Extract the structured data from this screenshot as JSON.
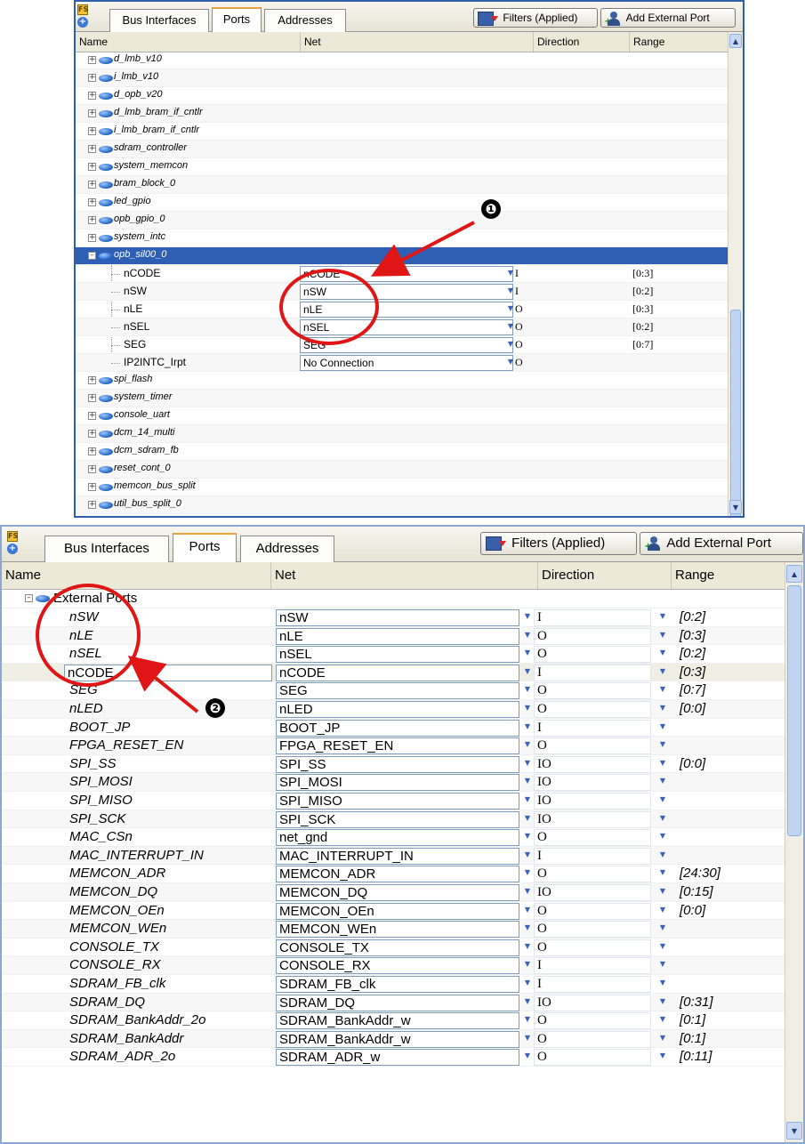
{
  "toolbar": {
    "tabs": [
      "Bus Interfaces",
      "Ports",
      "Addresses"
    ],
    "filters_label": "Filters (Applied)",
    "add_port_label": "Add External Port"
  },
  "columns": [
    "Name",
    "Net",
    "Direction",
    "Range"
  ],
  "top_panel": {
    "instances_before": [
      "d_lmb_v10",
      "i_lmb_v10",
      "d_opb_v20",
      "d_lmb_bram_if_cntlr",
      "i_lmb_bram_if_cntlr",
      "sdram_controller",
      "system_memcon",
      "bram_block_0",
      "led_gpio",
      "opb_gpio_0",
      "system_intc"
    ],
    "selected_instance": "opb_sil00_0",
    "ports": [
      {
        "name": "nCODE",
        "net": "nCODE",
        "dir": "I",
        "range": "[0:3]"
      },
      {
        "name": "nSW",
        "net": "nSW",
        "dir": "I",
        "range": "[0:2]"
      },
      {
        "name": "nLE",
        "net": "nLE",
        "dir": "O",
        "range": "[0:3]"
      },
      {
        "name": "nSEL",
        "net": "nSEL",
        "dir": "O",
        "range": "[0:2]"
      },
      {
        "name": "SEG",
        "net": "SEG",
        "dir": "O",
        "range": "[0:7]"
      },
      {
        "name": "IP2INTC_Irpt",
        "net": "No Connection",
        "dir": "O",
        "range": ""
      }
    ],
    "instances_after": [
      "spi_flash",
      "system_timer",
      "console_uart",
      "dcm_14_multi",
      "dcm_sdram_fb",
      "reset_cont_0",
      "memcon_bus_split",
      "util_bus_split_0"
    ]
  },
  "bottom_panel": {
    "group": "External Ports",
    "ports": [
      {
        "name": "nSW",
        "net": "nSW",
        "dir": "I",
        "range": "[0:2]"
      },
      {
        "name": "nLE",
        "net": "nLE",
        "dir": "O",
        "range": "[0:3]"
      },
      {
        "name": "nSEL",
        "net": "nSEL",
        "dir": "O",
        "range": "[0:2]"
      },
      {
        "name": "nCODE",
        "net": "nCODE",
        "dir": "I",
        "range": "[0:3]"
      },
      {
        "name": "SEG",
        "net": "SEG",
        "dir": "O",
        "range": "[0:7]"
      },
      {
        "name": "nLED",
        "net": "nLED",
        "dir": "O",
        "range": "[0:0]"
      },
      {
        "name": "BOOT_JP",
        "net": "BOOT_JP",
        "dir": "I",
        "range": ""
      },
      {
        "name": "FPGA_RESET_EN",
        "net": "FPGA_RESET_EN",
        "dir": "O",
        "range": ""
      },
      {
        "name": "SPI_SS",
        "net": "SPI_SS",
        "dir": "IO",
        "range": "[0:0]"
      },
      {
        "name": "SPI_MOSI",
        "net": "SPI_MOSI",
        "dir": "IO",
        "range": ""
      },
      {
        "name": "SPI_MISO",
        "net": "SPI_MISO",
        "dir": "IO",
        "range": ""
      },
      {
        "name": "SPI_SCK",
        "net": "SPI_SCK",
        "dir": "IO",
        "range": ""
      },
      {
        "name": "MAC_CSn",
        "net": "net_gnd",
        "dir": "O",
        "range": ""
      },
      {
        "name": "MAC_INTERRUPT_IN",
        "net": "MAC_INTERRUPT_IN",
        "dir": "I",
        "range": ""
      },
      {
        "name": "MEMCON_ADR",
        "net": "MEMCON_ADR",
        "dir": "O",
        "range": "[24:30]"
      },
      {
        "name": "MEMCON_DQ",
        "net": "MEMCON_DQ",
        "dir": "IO",
        "range": "[0:15]"
      },
      {
        "name": "MEMCON_OEn",
        "net": "MEMCON_OEn",
        "dir": "O",
        "range": "[0:0]"
      },
      {
        "name": "MEMCON_WEn",
        "net": "MEMCON_WEn",
        "dir": "O",
        "range": ""
      },
      {
        "name": "CONSOLE_TX",
        "net": "CONSOLE_TX",
        "dir": "O",
        "range": ""
      },
      {
        "name": "CONSOLE_RX",
        "net": "CONSOLE_RX",
        "dir": "I",
        "range": ""
      },
      {
        "name": "SDRAM_FB_clk",
        "net": "SDRAM_FB_clk",
        "dir": "I",
        "range": ""
      },
      {
        "name": "SDRAM_DQ",
        "net": "SDRAM_DQ",
        "dir": "IO",
        "range": "[0:31]"
      },
      {
        "name": "SDRAM_BankAddr_2o",
        "net": "SDRAM_BankAddr_w",
        "dir": "O",
        "range": "[0:1]"
      },
      {
        "name": "SDRAM_BankAddr",
        "net": "SDRAM_BankAddr_w",
        "dir": "O",
        "range": "[0:1]"
      },
      {
        "name": "SDRAM_ADR_2o",
        "net": "SDRAM_ADR_w",
        "dir": "O",
        "range": "[0:11]"
      }
    ]
  },
  "annotations": {
    "marker_1": "❶",
    "marker_2": "❷"
  },
  "colors": {
    "selection": "#2f5fb5",
    "annotation": "#e01616",
    "tab_accent": "#e8a33c"
  }
}
